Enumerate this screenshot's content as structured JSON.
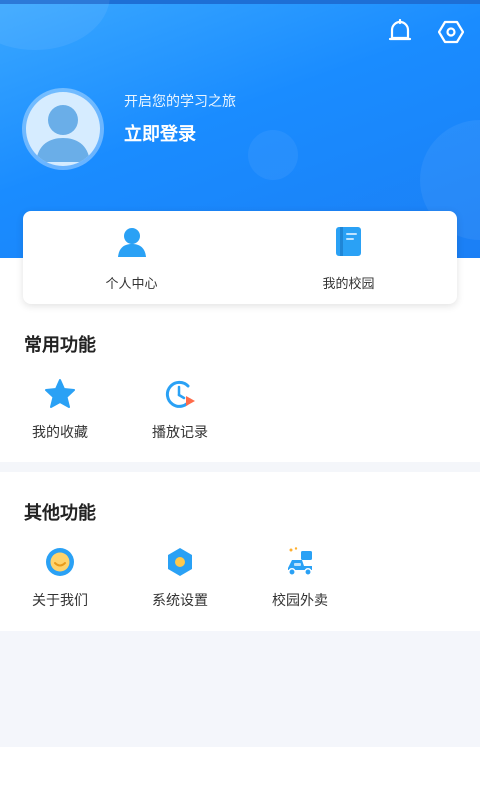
{
  "header": {
    "subtitle": "开启您的学习之旅",
    "login_label": "立即登录",
    "accent_color": "#1a8cff"
  },
  "top_icons": [
    "bell-icon",
    "settings-hexagon-icon"
  ],
  "card": {
    "items": [
      {
        "label": "个人中心",
        "icon": "person-icon"
      },
      {
        "label": "我的校园",
        "icon": "book-icon"
      }
    ]
  },
  "common": {
    "title": "常用功能",
    "items": [
      {
        "label": "我的收藏",
        "icon": "star-icon"
      },
      {
        "label": "播放记录",
        "icon": "play-history-icon"
      }
    ]
  },
  "other": {
    "title": "其他功能",
    "items": [
      {
        "label": "关于我们",
        "icon": "smile-icon"
      },
      {
        "label": "系统设置",
        "icon": "settings-icon"
      },
      {
        "label": "校园外卖",
        "icon": "delivery-scooter-icon"
      }
    ]
  }
}
